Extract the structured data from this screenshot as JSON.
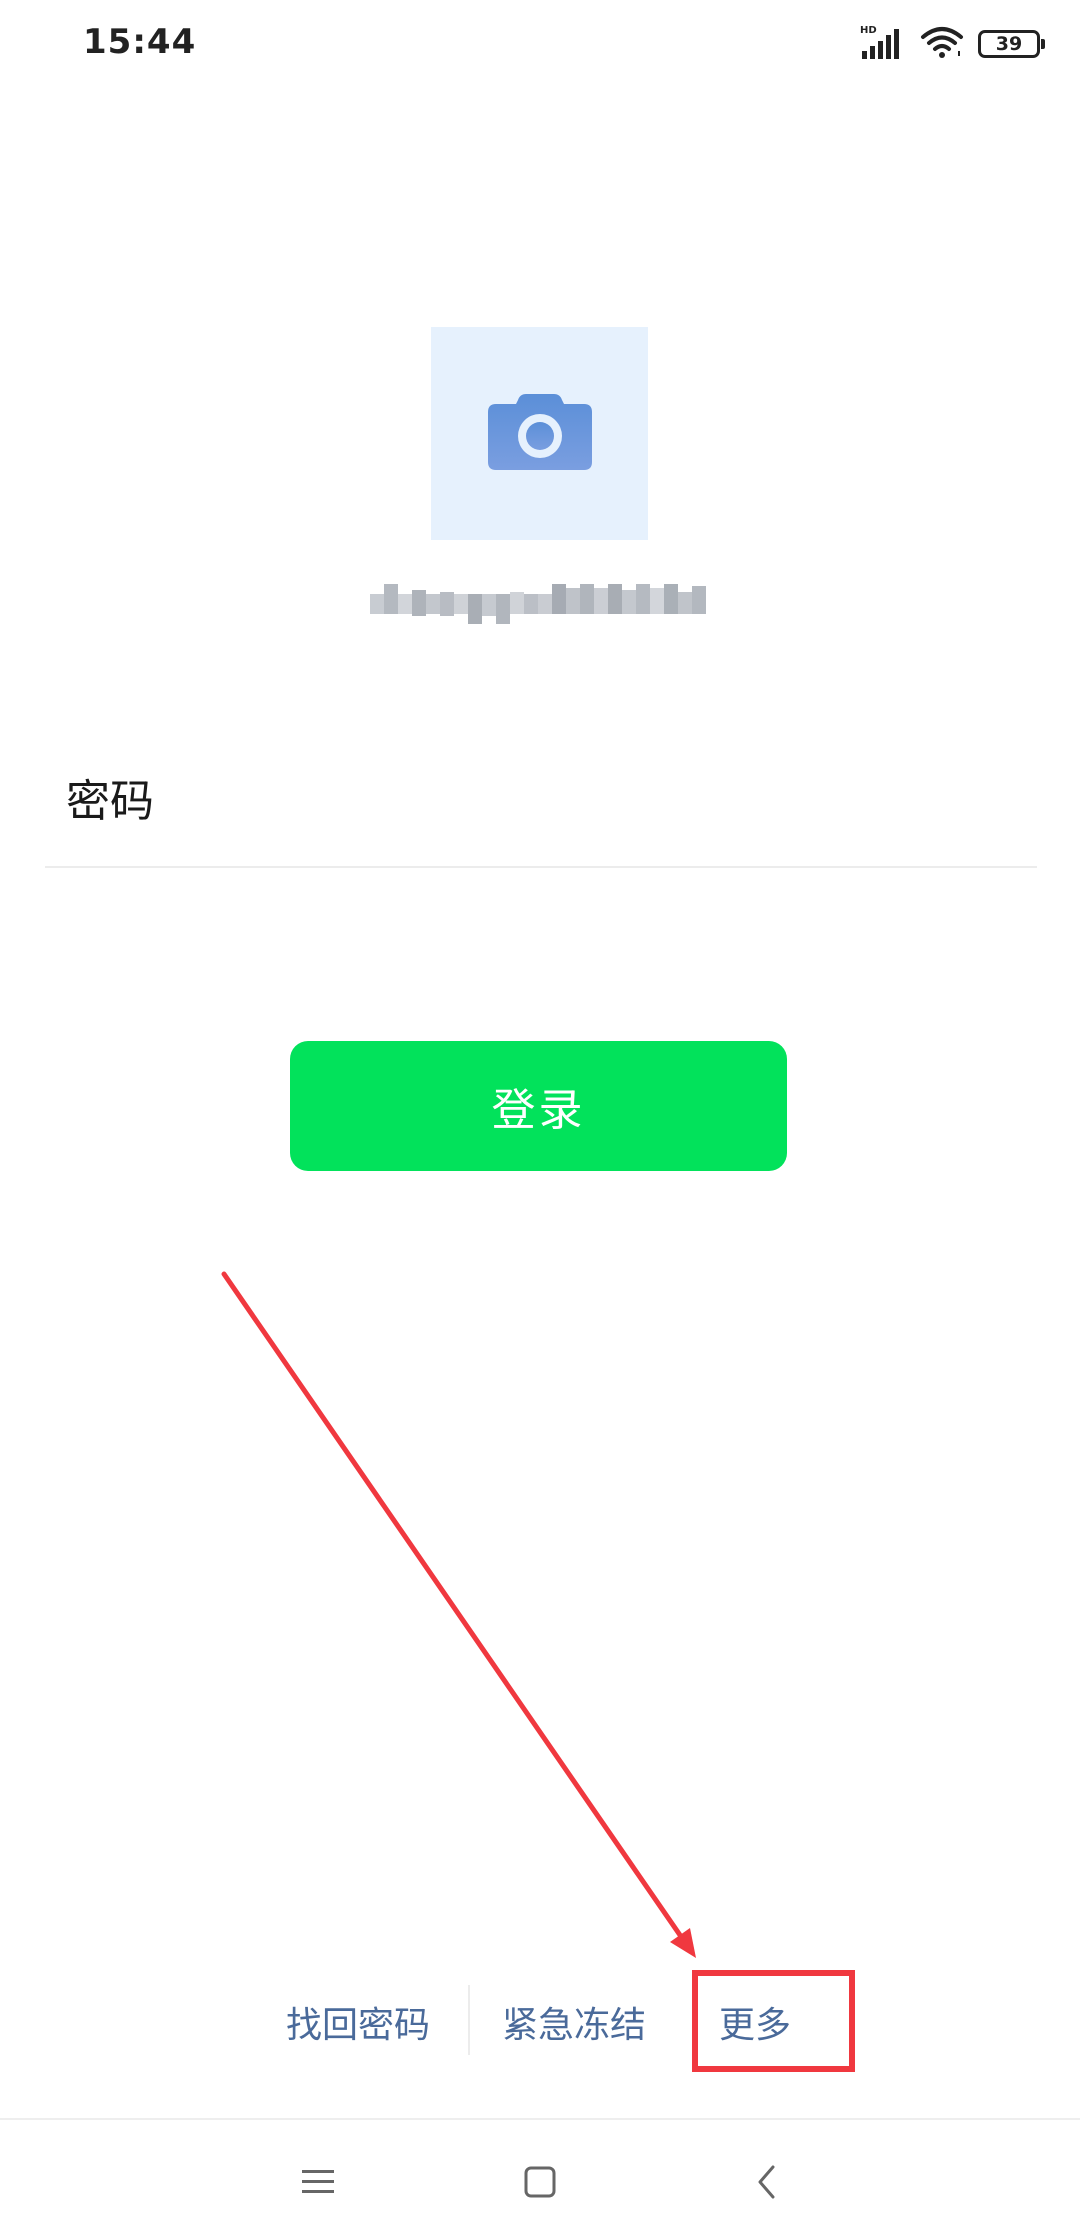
{
  "status_bar": {
    "time": "15:44",
    "network_badge": "HD",
    "battery_level": "39",
    "icons": [
      "signal-icon",
      "wifi-icon",
      "battery-icon"
    ]
  },
  "profile": {
    "avatar_icon": "camera-icon",
    "username_redacted": true
  },
  "form": {
    "password_label": "密码",
    "login_label": "登录"
  },
  "footer_links": {
    "recover_password": "找回密码",
    "emergency_freeze": "紧急冻结",
    "more": "更多"
  },
  "nav_bar": {
    "icons": [
      "menu-icon",
      "home-icon",
      "back-icon"
    ]
  },
  "colors": {
    "primary_button": "#02e25b",
    "link": "#4a6a9a",
    "avatar_bg": "#e6f1fd",
    "annotation": "#f0383f"
  }
}
